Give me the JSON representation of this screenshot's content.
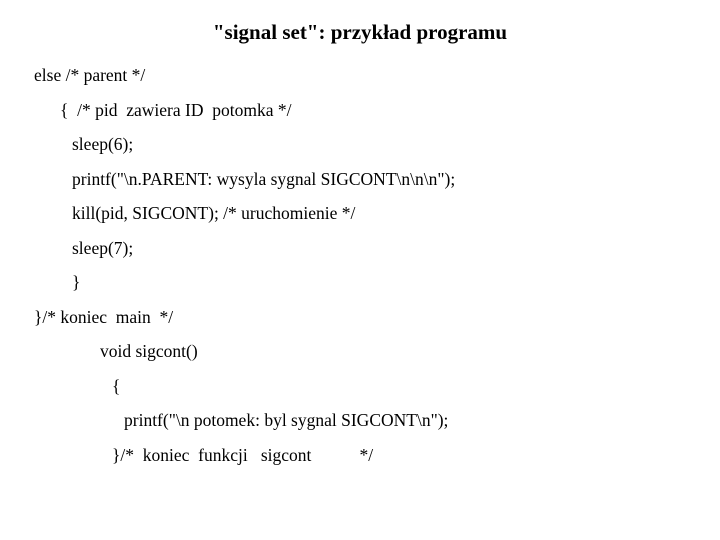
{
  "title": "\"signal set\": przykład programu",
  "code": {
    "l1": "else /* parent */",
    "l2": "{  /* pid  zawiera ID  potomka */",
    "l3": "sleep(6);",
    "l4": "printf(\"\\n.PARENT: wysyla sygnal SIGCONT\\n\\n\\n\");",
    "l5": "kill(pid, SIGCONT); /* uruchomienie */",
    "l6": "sleep(7);",
    "l7": "}",
    "l8": "}/* koniec  main  */",
    "l9": "void sigcont()",
    "l10": "{",
    "l11": "printf(\"\\n potomek: byl sygnal SIGCONT\\n\");",
    "l12": "}/*  koniec  funkcji   sigcont           */"
  }
}
